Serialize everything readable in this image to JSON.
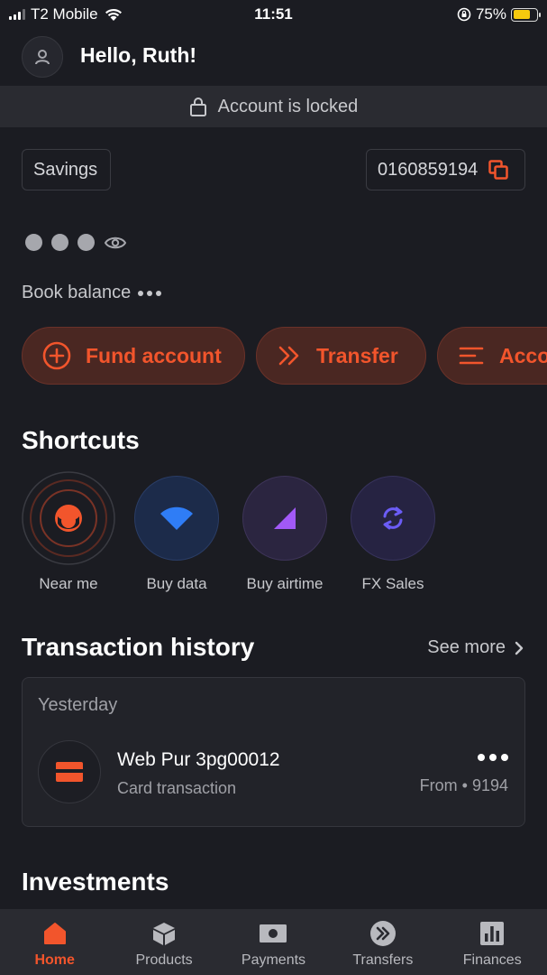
{
  "status_bar": {
    "carrier": "T2 Mobile",
    "time": "11:51",
    "battery": "75%",
    "battery_level": 0.75
  },
  "header": {
    "greeting": "Hello, Ruth!"
  },
  "lock_banner": {
    "text": "Account is locked"
  },
  "account": {
    "type_label": "Savings",
    "number": "0160859194"
  },
  "balance": {
    "book_label": "Book balance"
  },
  "actions": [
    {
      "label": "Fund account",
      "icon": "plus-circle-icon"
    },
    {
      "label": "Transfer",
      "icon": "double-chevron-icon"
    },
    {
      "label": "Acco",
      "icon": "menu-lines-icon"
    }
  ],
  "shortcuts": {
    "title": "Shortcuts",
    "items": [
      {
        "label": "Near me",
        "icon": "radar-icon"
      },
      {
        "label": "Buy data",
        "icon": "wifi-icon"
      },
      {
        "label": "Buy airtime",
        "icon": "signal-triangle-icon"
      },
      {
        "label": "FX Sales",
        "icon": "exchange-icon"
      }
    ]
  },
  "transactions": {
    "title": "Transaction history",
    "see_more": "See more",
    "group_label": "Yesterday",
    "items": [
      {
        "title": "Web Pur 3pg00012",
        "subtitle": "Card transaction",
        "meta": "From • 9194"
      }
    ]
  },
  "investments": {
    "title": "Investments"
  },
  "bottom_nav": [
    {
      "label": "Home",
      "icon": "home-icon",
      "active": true
    },
    {
      "label": "Products",
      "icon": "box-icon",
      "active": false
    },
    {
      "label": "Payments",
      "icon": "banknote-icon",
      "active": false
    },
    {
      "label": "Transfers",
      "icon": "transfer-icon",
      "active": false
    },
    {
      "label": "Finances",
      "icon": "bar-chart-icon",
      "active": false
    }
  ],
  "colors": {
    "accent": "#f2552c",
    "background": "#1b1c22",
    "surface": "#2a2b31"
  }
}
